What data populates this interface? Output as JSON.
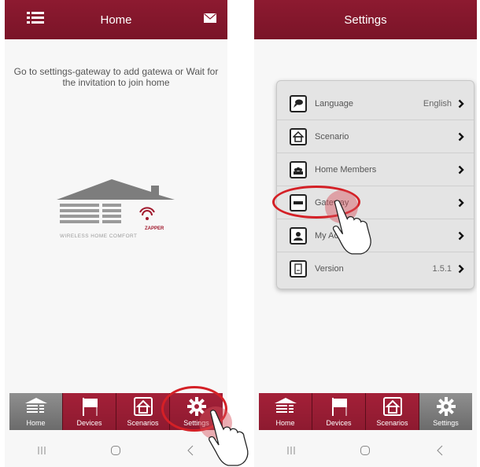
{
  "left_screen": {
    "header": {
      "title": "Home",
      "menu_icon": "menu-list-icon",
      "mail_icon": "envelope-icon"
    },
    "message": "Go to settings-gateway to add gatewa or Wait for the invitation to join home",
    "logo": {
      "brand": "ZAPPER",
      "tagline": "WIRELESS HOME COMFORT"
    }
  },
  "right_screen": {
    "header": {
      "title": "Settings"
    },
    "settings": [
      {
        "label": "Language",
        "value": "English",
        "icon": "chat-bubble-icon"
      },
      {
        "label": "Scenario",
        "value": "",
        "icon": "house-icon"
      },
      {
        "label": "Home Members",
        "value": "",
        "icon": "members-icon"
      },
      {
        "label": "Gateway",
        "value": "",
        "icon": "gateway-icon"
      },
      {
        "label": "My Account",
        "value": "",
        "icon": "person-icon"
      },
      {
        "label": "Version",
        "value": "1.5.1",
        "icon": "document-icon"
      }
    ]
  },
  "tabs": [
    {
      "label": "Home",
      "icon": "home-logo-icon"
    },
    {
      "label": "Devices",
      "icon": "flag-icon"
    },
    {
      "label": "Scenarios",
      "icon": "house-box-icon"
    },
    {
      "label": "Settings",
      "icon": "gear-icon"
    }
  ],
  "active_tab": {
    "left": "Home",
    "right": "Settings"
  },
  "system_nav": [
    "recent-apps-icon",
    "home-circle-icon",
    "back-chevron-icon"
  ],
  "colors": {
    "brand": "#8d1a30",
    "active_tab": "#7a7a7a",
    "highlight": "#d42026"
  }
}
